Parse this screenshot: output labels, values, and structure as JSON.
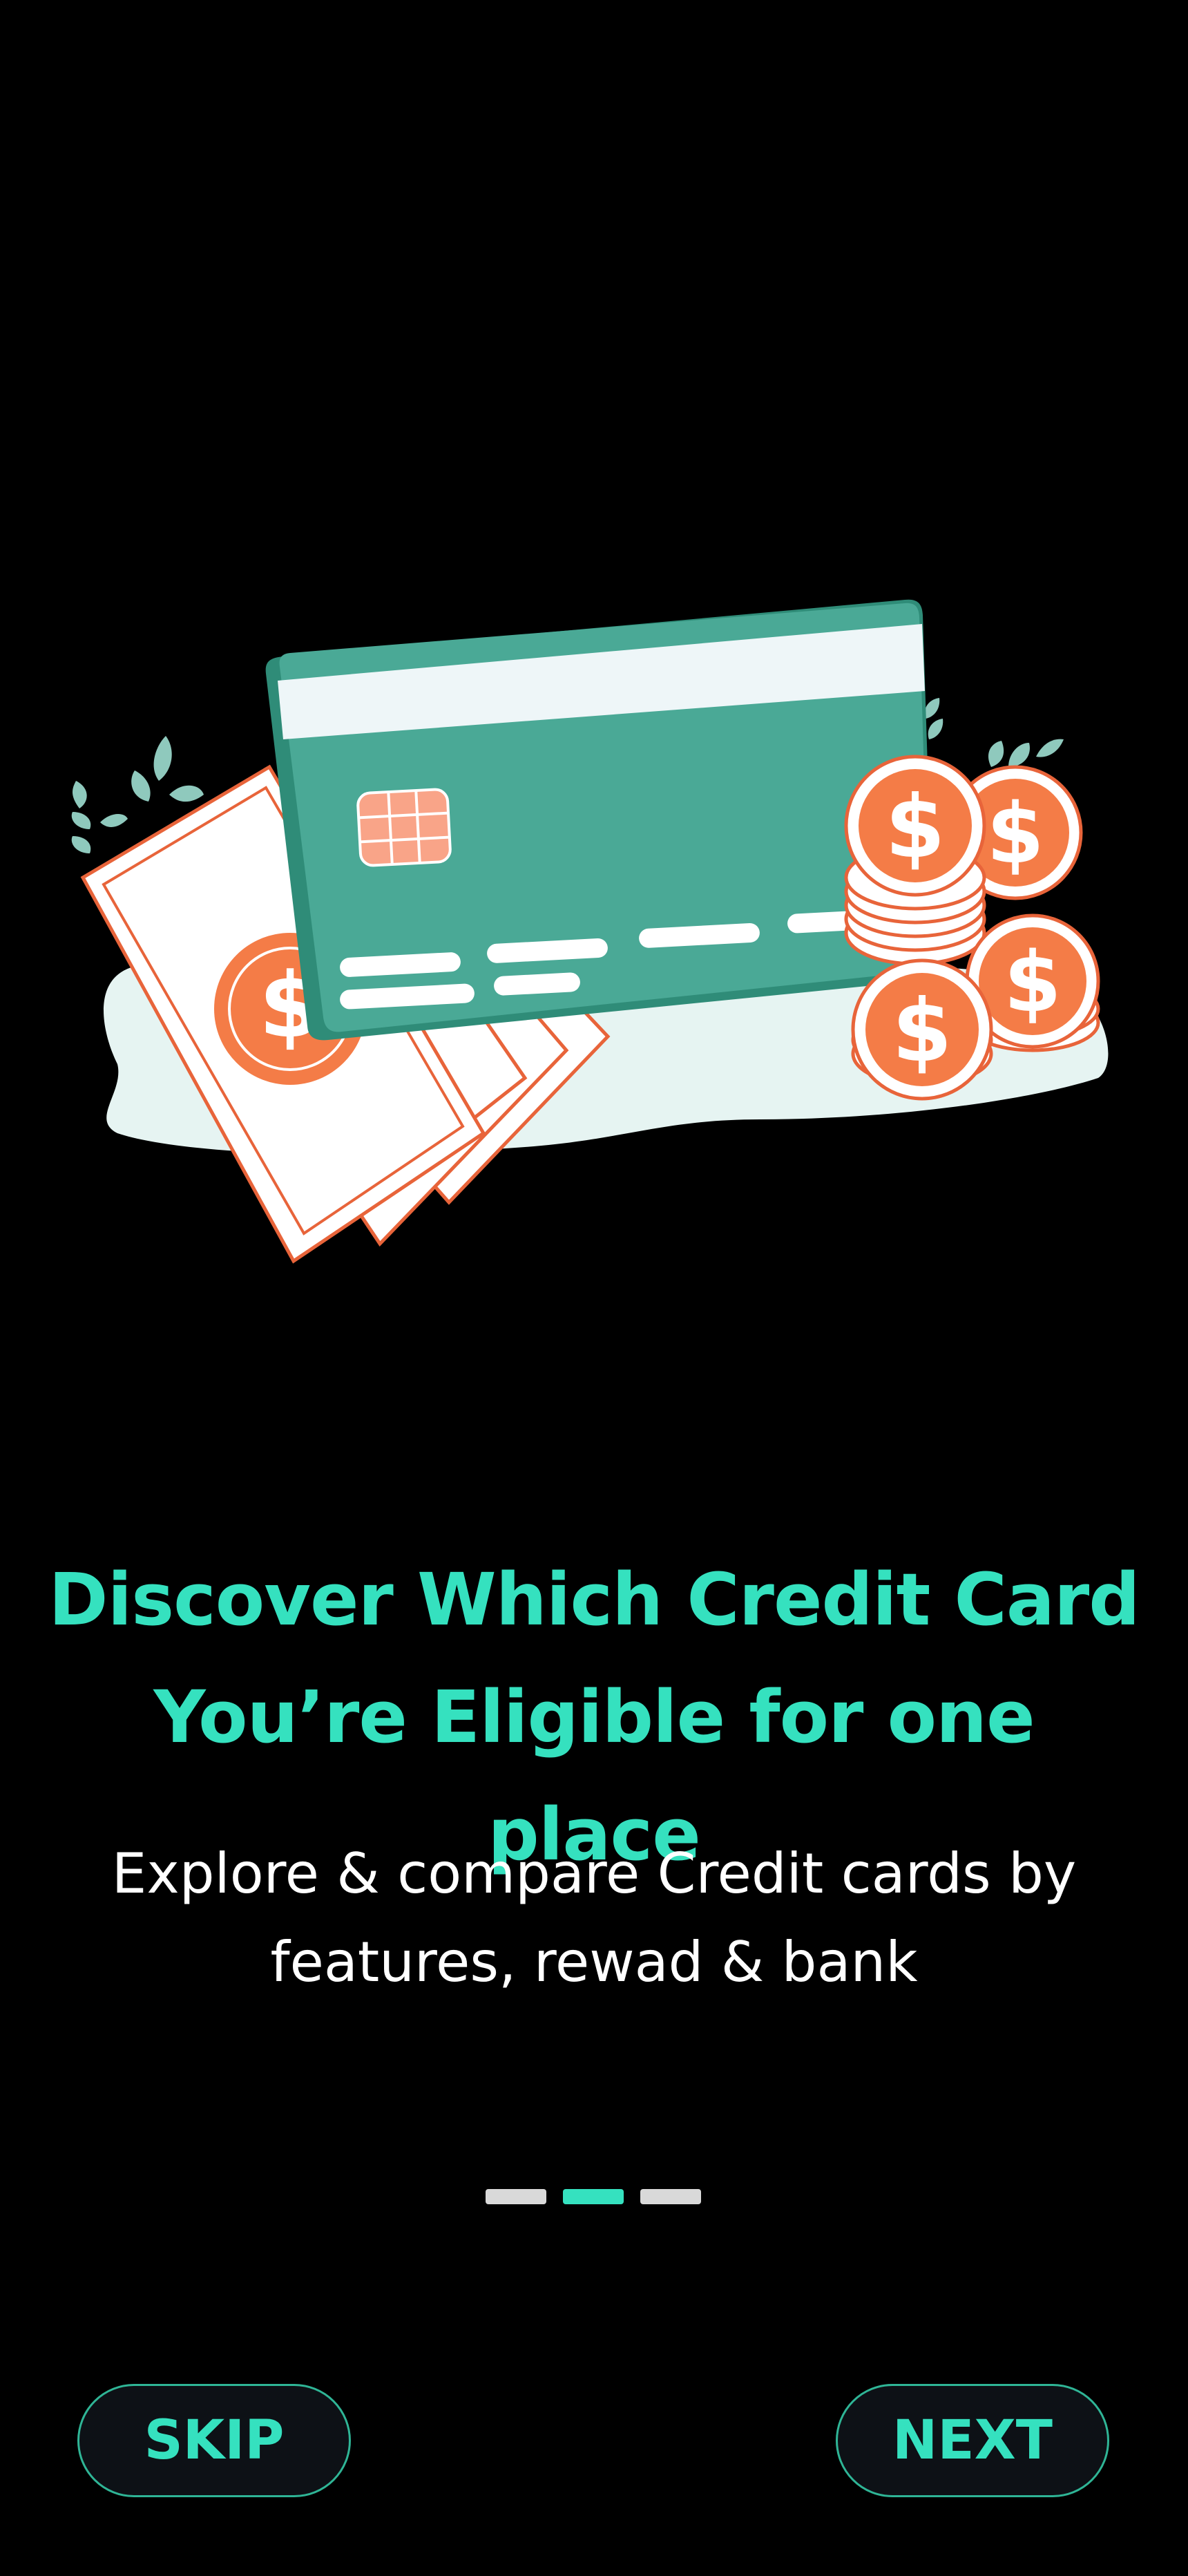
{
  "onboarding": {
    "headline_line1": "Discover Which Credit Card",
    "headline_line2": "You’re Eligible for one place",
    "subtitle_line1": "Explore & compare Credit cards by",
    "subtitle_line2": "features, rewad & bank",
    "illustration_icon": "credit-card-money-coins-illustration",
    "current_page": 2,
    "total_pages": 3
  },
  "buttons": {
    "skip_label": "SKIP",
    "next_label": "NEXT"
  },
  "colors": {
    "background": "#000000",
    "accent": "#35e1bf",
    "card": "#4aa996",
    "coin_orange": "#f47c47",
    "inactive_dot": "#d9d9d9"
  }
}
